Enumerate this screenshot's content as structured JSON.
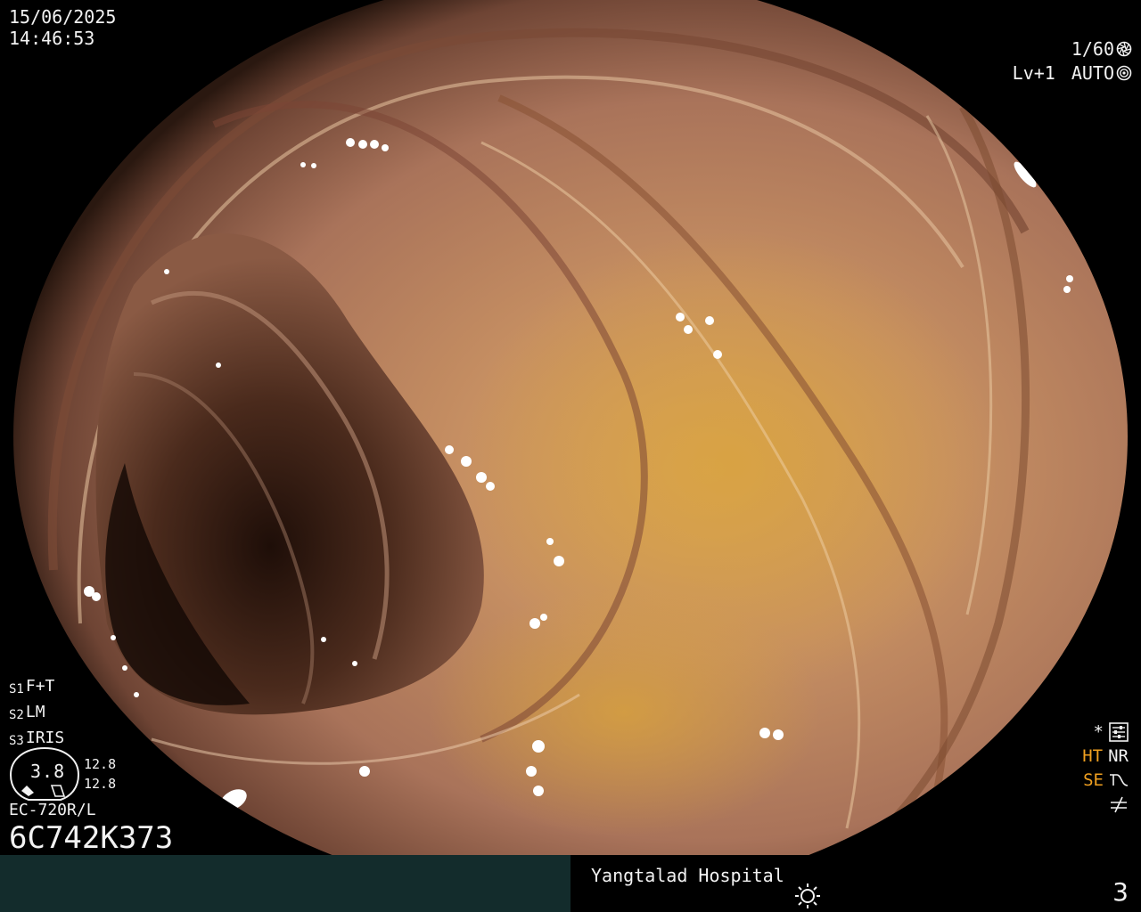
{
  "datetime": {
    "date": "15/06/2025",
    "time": "14:46:53"
  },
  "settings": {
    "shutter": "1/60",
    "shutter_icon": "aperture-icon",
    "level": "Lv+1",
    "iris_mode": "AUTO",
    "iris_icon": "auto-iris-icon"
  },
  "switches": [
    {
      "key": "S1",
      "value": "F+T"
    },
    {
      "key": "S2",
      "value": "LM"
    },
    {
      "key": "S3",
      "value": "IRIS"
    }
  ],
  "gauge": {
    "value": "3.8",
    "side_top": "12.8",
    "side_bottom": "12.8"
  },
  "scope": {
    "model": "EC-720R/L",
    "serial": "6C742K373"
  },
  "enhancements": {
    "star_label": "*",
    "star_icon": "settings-icon",
    "ht_label": "HT",
    "nr_label": "NR",
    "se_label": "SE",
    "se_icon": "sharpness-curve-icon",
    "ne_icon": "not-equal-icon",
    "ht_color": "#f0a020",
    "se_color": "#f0a020"
  },
  "footer": {
    "hospital": "Yangtalad Hospital",
    "light_icon": "brightness-icon",
    "page_number": "3",
    "bar_color": "#132c2c"
  }
}
